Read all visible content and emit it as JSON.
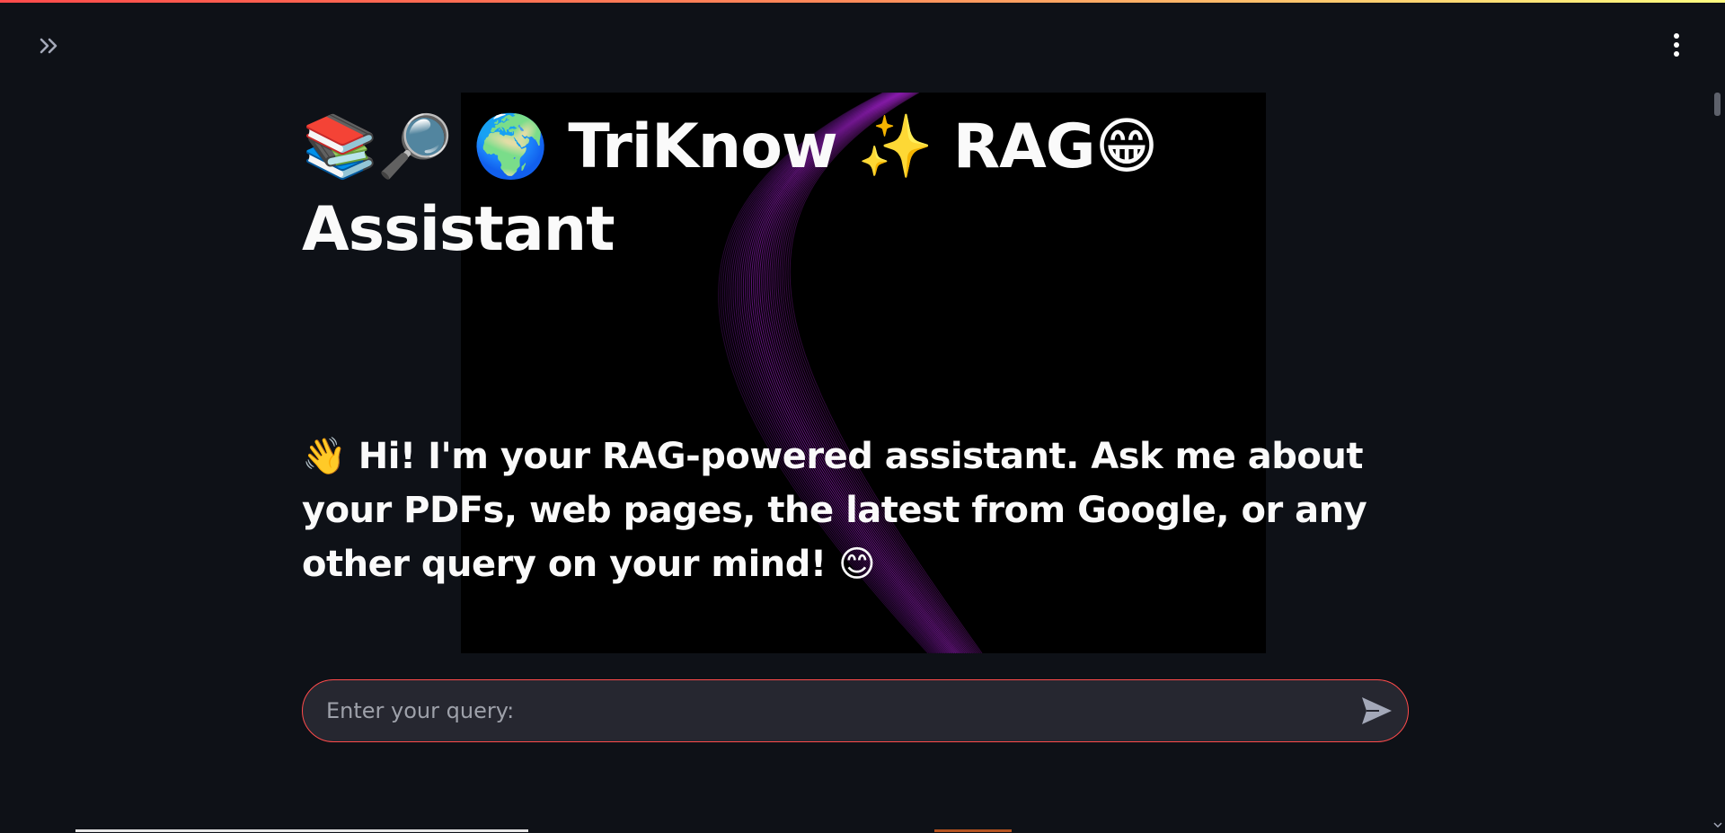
{
  "header": {
    "sidebar_toggle_icon": "double-chevron-right-icon",
    "menu_icon": "kebab-menu-icon"
  },
  "main": {
    "title": "📚🔎 🌍 TriKnow ✨ RAG😁 Assistant",
    "greeting": "👋 Hi! I'm your RAG-powered assistant. Ask me about your PDFs, web pages, the latest from Google, or any other query on your mind! 😊"
  },
  "query": {
    "placeholder": "Enter your query:",
    "value": "",
    "send_icon": "send-icon"
  },
  "colors": {
    "background": "#0e1117",
    "accent": "#ff4b4b",
    "input_bg": "#262730",
    "text": "#fafafa",
    "placeholder": "#9ea1aa"
  }
}
